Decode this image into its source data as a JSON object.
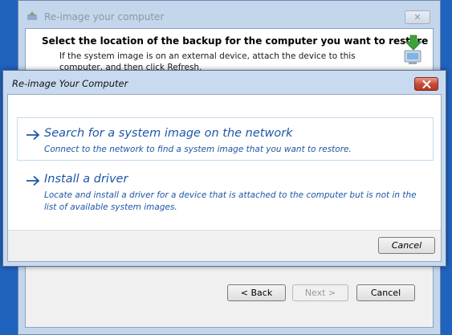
{
  "background_window": {
    "title": "Re-image your computer",
    "close_label": "✕",
    "heading": "Select the location of the backup for the computer you want to restore",
    "description": "If the system image is on an external device, attach the device to this computer, and then click Refresh.",
    "buttons": {
      "back": "< Back",
      "next": "Next >",
      "cancel": "Cancel"
    }
  },
  "dialog": {
    "title": "Re-image Your Computer",
    "options": [
      {
        "title": "Search for a system image on the network",
        "description": "Connect to the network to find a system image that you want to restore."
      },
      {
        "title": "Install a driver",
        "description": "Locate and install a driver for a device that is attached to the computer but is not in the list of available system images."
      }
    ],
    "cancel_label": "Cancel"
  },
  "colors": {
    "desktop": "#1f63bf",
    "link_blue": "#1e56a6",
    "close_red": "#c84534"
  },
  "icons": {
    "title_icon": "reimage-icon",
    "arrow": "right-arrow-icon",
    "computer": "computer-restore-icon"
  }
}
